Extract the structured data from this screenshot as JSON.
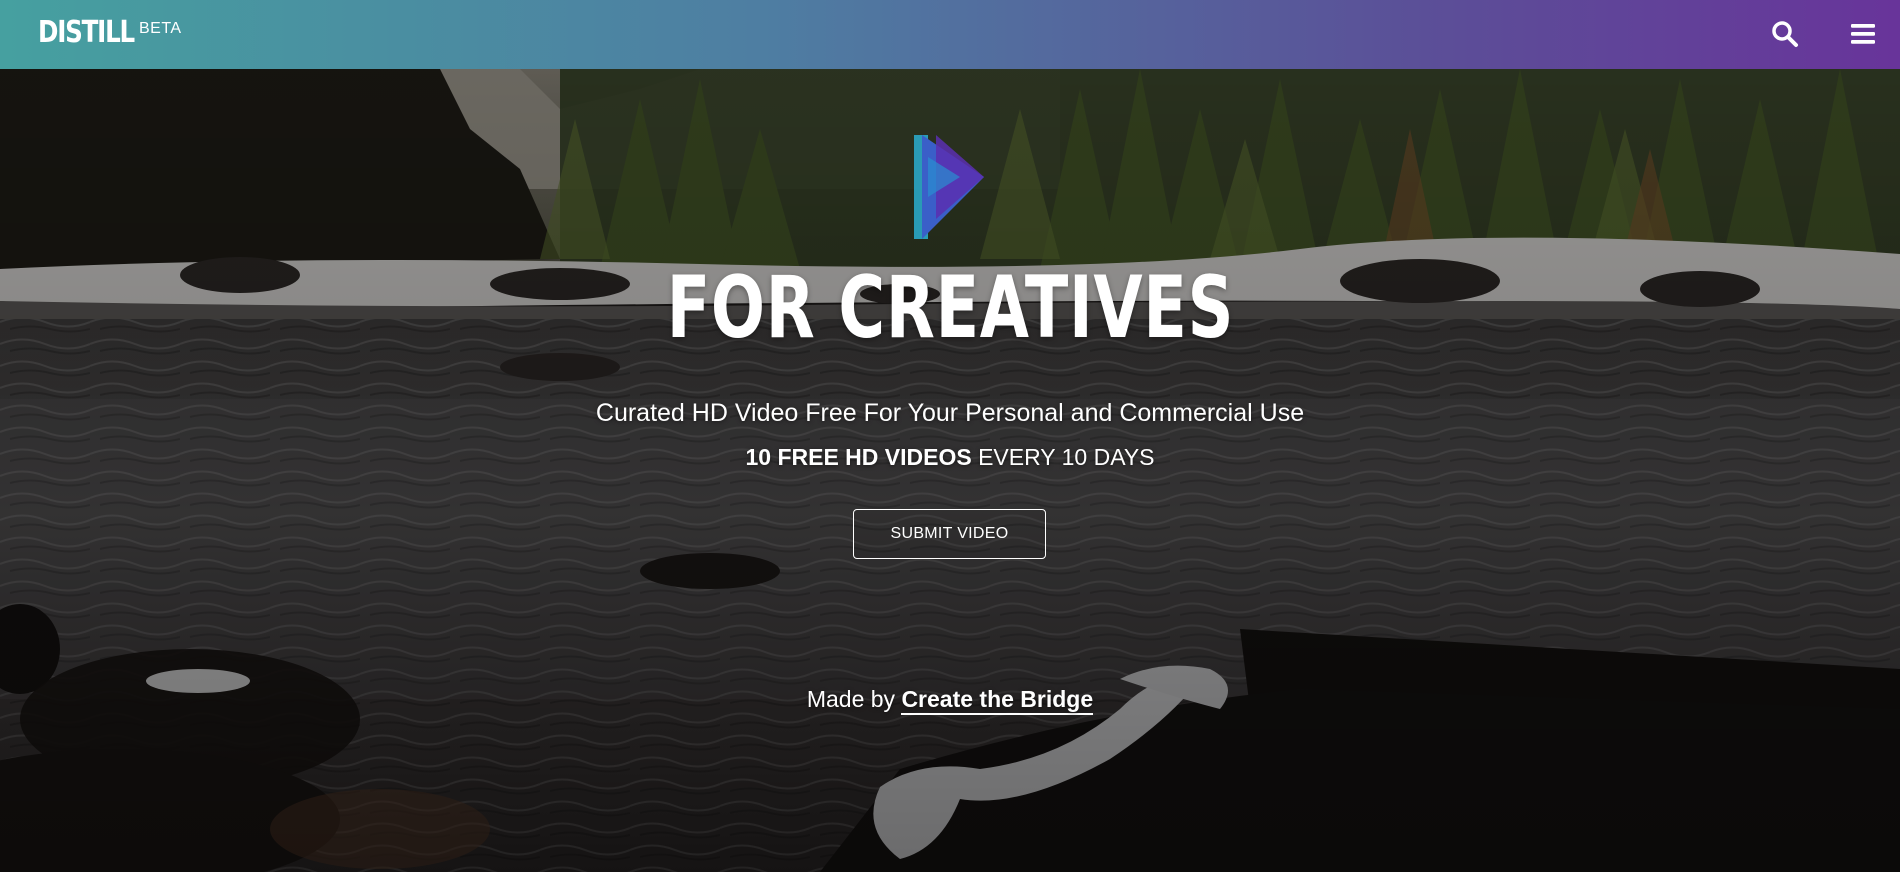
{
  "header": {
    "logo": "DISTILL",
    "badge": "BETA",
    "search_icon": "search-icon",
    "menu_icon": "hamburger-menu-icon",
    "gradient": [
      "#46a0a0",
      "#68349a"
    ]
  },
  "hero": {
    "title": "FOR CREATIVES",
    "subtitle": "Curated HD Video Free For Your Personal and Commercial Use",
    "promo_bold": "10 FREE HD VIDEOS",
    "promo_rest": " EVERY 10 DAYS",
    "submit_label": "SUBMIT VIDEO",
    "made_by_prefix": "Made by ",
    "made_by_link": "Create the Bridge"
  },
  "colors": {
    "text": "#ffffff",
    "brand_teal": "#2aa7c6",
    "brand_blue": "#3a5fc8",
    "brand_purple": "#5a2fb0"
  }
}
